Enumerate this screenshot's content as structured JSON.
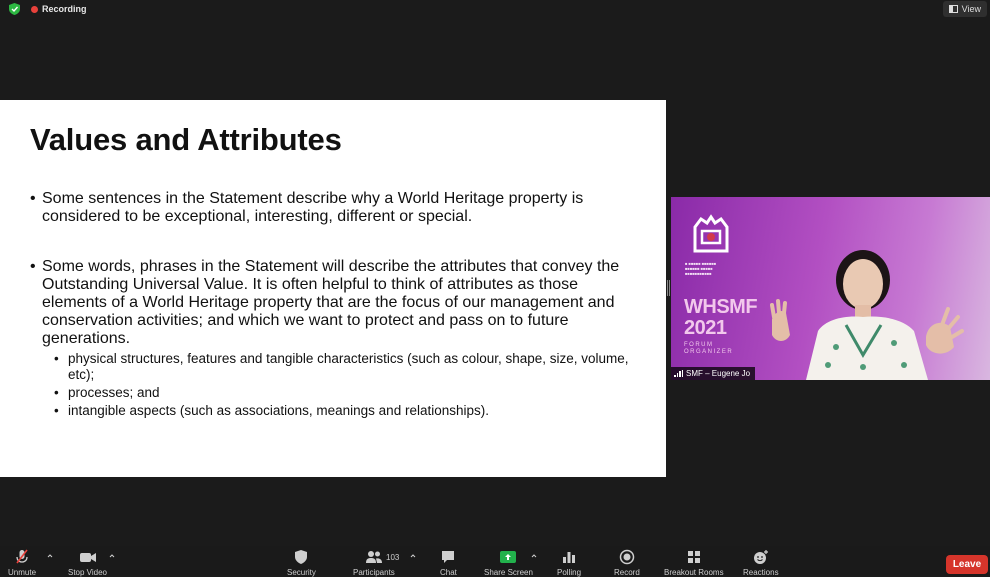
{
  "top_bar": {
    "recording_label": "Recording",
    "view_label": "View"
  },
  "slide": {
    "title": "Values and Attributes",
    "bullets": [
      "Some sentences in the Statement describe why a World Heritage property is considered to be exceptional, interesting, different or special.",
      "Some words, phrases in the Statement will describe the attributes that convey the Outstanding Universal Value. It is often helpful to think of attributes as those elements of a World Heritage property that are the focus of our management and conservation activities; and which we want to protect and pass on to future generations."
    ],
    "sub_bullets": [
      "physical structures, features and tangible characteristics (such as colour, shape, size, volume, etc);",
      "processes; and",
      "intangible aspects (such as associations, meanings and relationships)."
    ]
  },
  "video": {
    "participant_name": "SMF – Eugene Jo",
    "logo_text": "WHSMF 2021",
    "logo_subtext": "FORUM ORGANIZER",
    "background_color": "#9b3bb5"
  },
  "toolbar": {
    "unmute": "Unmute",
    "stop_video": "Stop Video",
    "security": "Security",
    "participants": "Participants",
    "participants_count": "103",
    "chat": "Chat",
    "share_screen": "Share Screen",
    "polling": "Polling",
    "record": "Record",
    "breakout_rooms": "Breakout Rooms",
    "reactions": "Reactions",
    "leave": "Leave"
  },
  "colors": {
    "leave": "#d6352b",
    "share_screen": "#22b14c",
    "recording_dot": "#e8413b"
  }
}
